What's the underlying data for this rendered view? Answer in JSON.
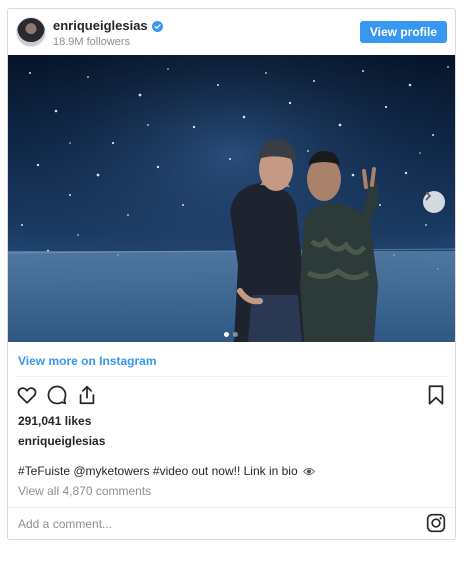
{
  "header": {
    "username": "enriqueiglesias",
    "followers": "18.9M followers",
    "view_profile_label": "View profile"
  },
  "post": {
    "carousel": {
      "slide_count": 2,
      "active_slide": 1
    },
    "view_more_label": "View more on Instagram",
    "likes": "291,041 likes",
    "owner": "enriqueiglesias",
    "caption": "#TeFuiste @myketowers #video out now!! Link in bio",
    "comments_link": "View all 4,870 comments"
  },
  "comment_box": {
    "placeholder": "Add a comment..."
  },
  "icons": {
    "verified": "verified-badge-icon",
    "like": "heart-icon",
    "comment": "comment-bubble-icon",
    "share": "share-icon",
    "save": "bookmark-icon",
    "next": "chevron-right-icon",
    "eye": "eye-emoji-icon",
    "logo": "instagram-logo-icon"
  },
  "colors": {
    "accent": "#3897f0",
    "text": "#262626",
    "muted": "#8e8e8e",
    "border": "#dbdbdb"
  }
}
